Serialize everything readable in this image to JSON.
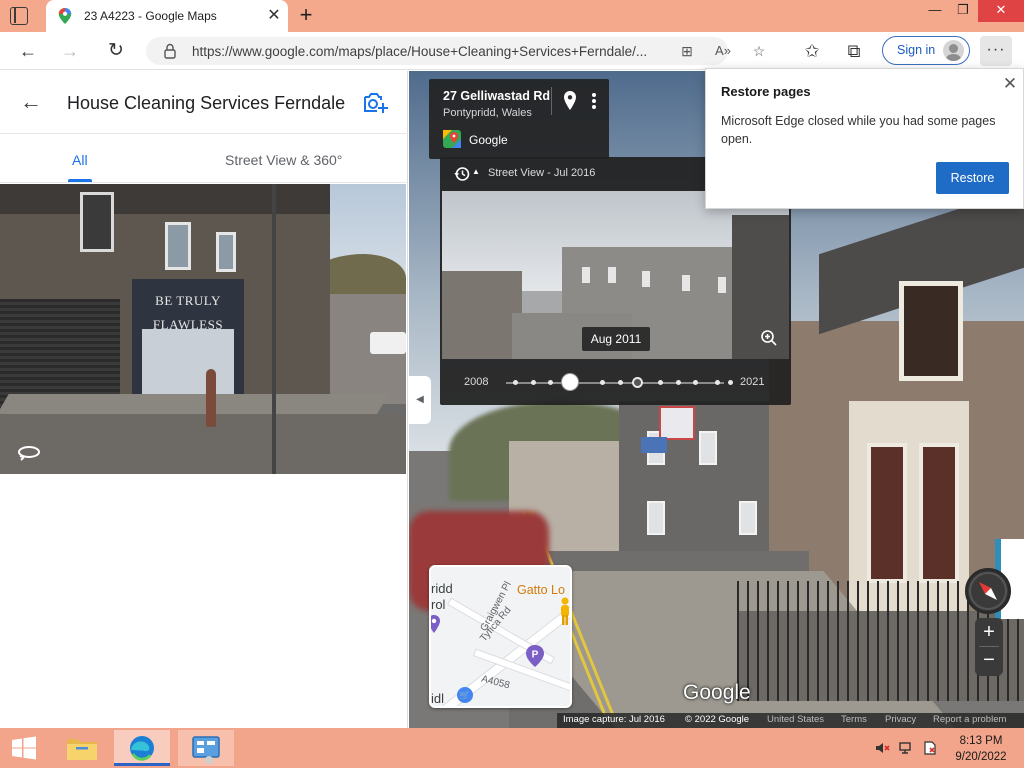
{
  "browser": {
    "tab_title": "23 A4223 - Google Maps",
    "url": "https://www.google.com/maps/place/House+Cleaning+Services+Ferndale/...",
    "signin_label": "Sign in"
  },
  "panel": {
    "title": "House Cleaning Services Ferndale",
    "tabs": [
      {
        "label": "All",
        "active": true
      },
      {
        "label": "Street View & 360°",
        "active": false
      }
    ],
    "photo_sign": "BE TRULY FLAWLESS"
  },
  "streetview": {
    "address": "27 Gelliwastad Rd",
    "city": "Pontypridd, Wales",
    "brand": "Google",
    "time_label": "Street View - Jul 2016",
    "preview_date": "Aug 2011",
    "year_start": "2008",
    "year_end": "2021",
    "logo": "Google",
    "attribution": {
      "capture": "Image capture: Jul 2016",
      "copyright": "© 2022 Google",
      "country": "United States",
      "terms": "Terms",
      "privacy": "Privacy",
      "report": "Report a problem"
    },
    "minimap": {
      "label_1": "ridd",
      "label_2": "rol",
      "label_3": "idl",
      "road_1": "Graigwen Pl",
      "road_2": "Tyfica Rd",
      "road_3": "A4058",
      "place": "Gatto Lo",
      "parking": "P"
    },
    "zoom_in": "+",
    "zoom_out": "−"
  },
  "restore_popup": {
    "title": "Restore pages",
    "message": "Microsoft Edge closed while you had some pages open.",
    "button": "Restore"
  },
  "taskbar": {
    "time": "8:13 PM",
    "date": "9/20/2022"
  },
  "colors": {
    "accent_blue": "#1a73e8",
    "restore_button": "#1f6cc7",
    "taskbar": "#f2a58a",
    "tabstrip": "#f4a98c"
  }
}
